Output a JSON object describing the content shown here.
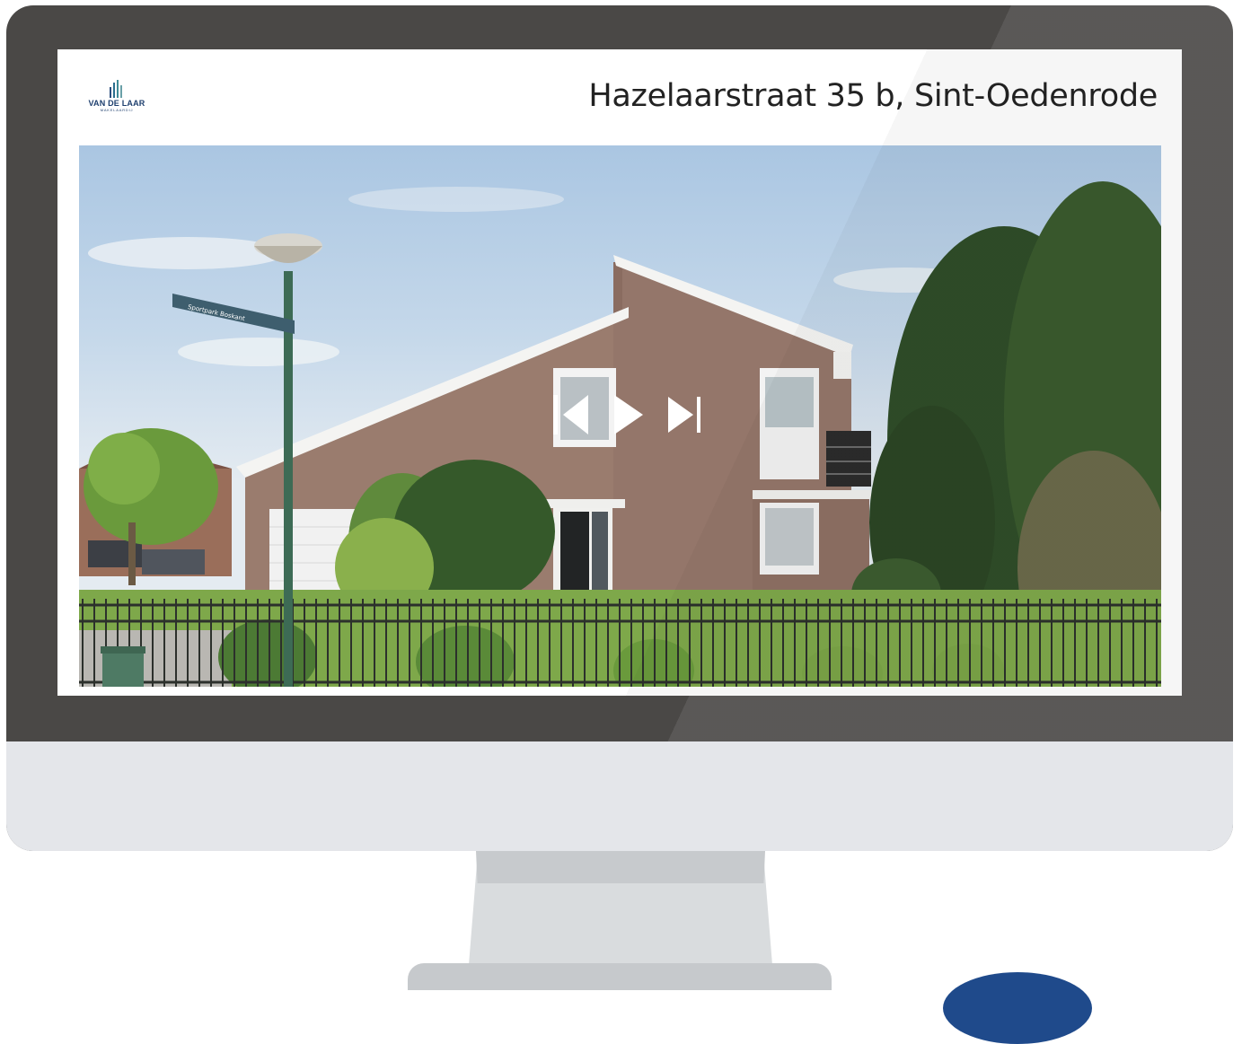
{
  "brand": {
    "name": "VAN DE LAAR",
    "subtitle": "MAKELAARDIJ",
    "color": "#1e3f6e"
  },
  "listing": {
    "address": "Hazelaarstraat 35 b, Sint-Oedenrode"
  },
  "photo": {
    "street_sign": "Sportpark Boskant"
  },
  "controls": {
    "previous_icon": "triangle-left-icon",
    "next_icon": "triangle-right-icon",
    "skip_end_icon": "skip-to-end-icon"
  },
  "colors": {
    "bezel": "#4a4846",
    "chin": "#e4e6ea",
    "stand": "#d9dcde",
    "badge": "#1f4a8b"
  }
}
